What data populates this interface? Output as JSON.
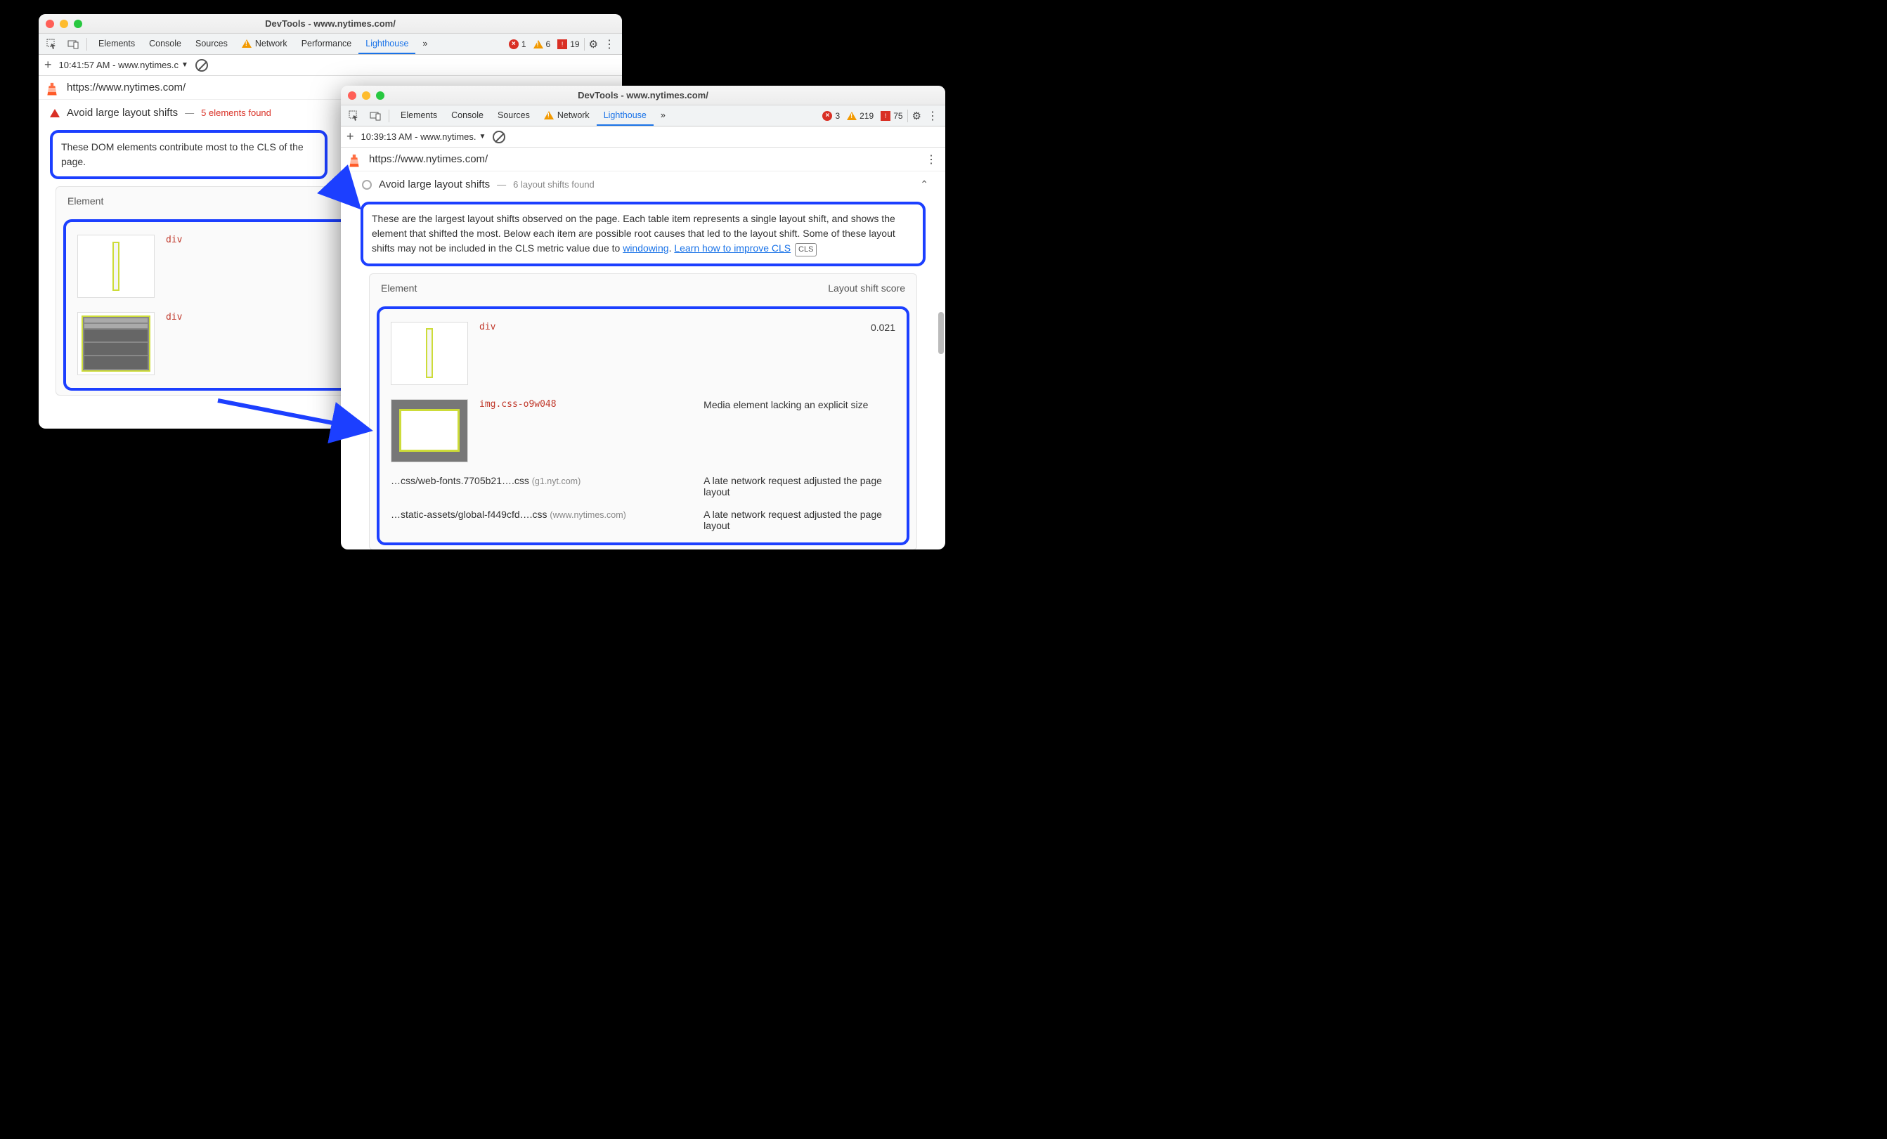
{
  "windowA": {
    "title": "DevTools - www.nytimes.com/",
    "tabs": [
      "Elements",
      "Console",
      "Sources",
      "Network",
      "Performance",
      "Lighthouse"
    ],
    "activeTab": "Lighthouse",
    "warnTab": "Network",
    "moreGlyph": "»",
    "counts": {
      "errors": "1",
      "warnings": "6",
      "issues": "19"
    },
    "sub": {
      "timestamp": "10:41:57 AM - www.nytimes.c"
    },
    "url": "https://www.nytimes.com/",
    "audit": {
      "title": "Avoid large layout shifts",
      "found": "5 elements found",
      "desc": "These DOM elements contribute most to the CLS of the page.",
      "elementHeader": "Element",
      "rows": [
        {
          "code": "div"
        },
        {
          "code": "div"
        }
      ]
    }
  },
  "windowB": {
    "title": "DevTools - www.nytimes.com/",
    "tabs": [
      "Elements",
      "Console",
      "Sources",
      "Network",
      "Lighthouse"
    ],
    "activeTab": "Lighthouse",
    "warnTab": "Network",
    "moreGlyph": "»",
    "counts": {
      "errors": "3",
      "warnings": "219",
      "issues": "75"
    },
    "sub": {
      "timestamp": "10:39:13 AM - www.nytimes."
    },
    "url": "https://www.nytimes.com/",
    "audit": {
      "title": "Avoid large layout shifts",
      "found": "6 layout shifts found",
      "desc1": "These are the largest layout shifts observed on the page. Each table item represents a single layout shift, and shows the element that shifted the most. Below each item are possible root causes that led to the layout shift. Some of these layout shifts may not be included in the CLS metric value due to ",
      "linkWindowing": "windowing",
      "period": ". ",
      "linkLearn": "Learn how to improve CLS",
      "clsBadge": "CLS",
      "headerElement": "Element",
      "headerScore": "Layout shift score",
      "row1": {
        "code": "div",
        "score": "0.021"
      },
      "row2": {
        "code": "img.css-o9w048",
        "reason": "Media element lacking an explicit size"
      },
      "row3": {
        "file": "…css/web-fonts.7705b21….css",
        "host": "(g1.nyt.com)",
        "reason": "A late network request adjusted the page layout"
      },
      "row4": {
        "file": "…static-assets/global-f449cfd….css",
        "host": "(www.nytimes.com)",
        "reason": "A late network request adjusted the page layout"
      }
    }
  }
}
